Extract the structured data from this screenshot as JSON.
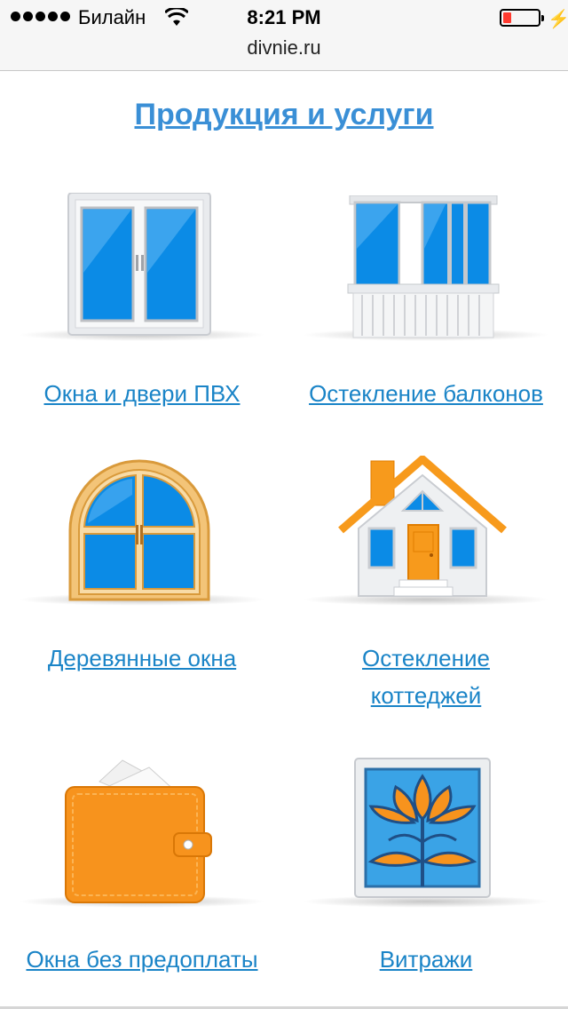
{
  "status_bar": {
    "carrier": "Билайн",
    "time": "8:21 PM",
    "signal_bars": 5,
    "battery_level_percent": 15,
    "battery_color": "#ff3b30"
  },
  "browser": {
    "url": "divnie.ru"
  },
  "page": {
    "title": "Продукция и услуги",
    "link_color": "#1a84c7",
    "title_color": "#3a8fd6"
  },
  "products": [
    {
      "label": "Окна и двери ПВХ",
      "icon": "pvc-window-icon"
    },
    {
      "label": "Остекление балконов",
      "icon": "balcony-icon"
    },
    {
      "label": "Деревянные окна",
      "icon": "wooden-arched-window-icon"
    },
    {
      "label_line1": "Остекление",
      "label_line2": "коттеджей",
      "icon": "house-icon"
    },
    {
      "label": "Окна без предоплаты",
      "icon": "wallet-icon"
    },
    {
      "label": "Витражи",
      "icon": "stained-glass-icon"
    }
  ]
}
